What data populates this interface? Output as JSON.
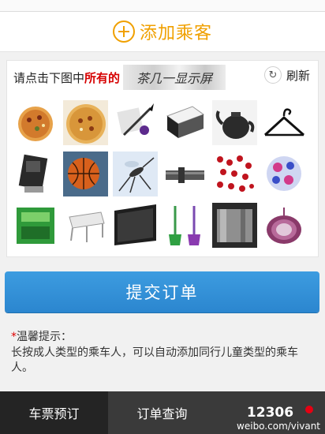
{
  "add_passenger": {
    "label": "添加乘客",
    "icon": "plus-circle-icon"
  },
  "captcha": {
    "instruction_prefix": "请点击下图中",
    "instruction_highlight": "所有的",
    "target_words": "茶几一显示屏",
    "refresh_label": "刷新",
    "images": [
      "pizza",
      "pizza",
      "pen",
      "box",
      "teapot",
      "hanger",
      "device",
      "basketball",
      "mosquito",
      "pipe",
      "red-beads",
      "ball",
      "green-box",
      "tray",
      "display",
      "broom",
      "metal-pot",
      "onion"
    ]
  },
  "submit_label": "提交订单",
  "tips": {
    "star": "*",
    "title": "温馨提示：",
    "body": "长按成人类型的乘车人，可以自动添加同行儿童类型的乘车人。"
  },
  "tabs": [
    {
      "label": "车票预订",
      "active": true
    },
    {
      "label": "订单查询",
      "active": false
    },
    {
      "label": "12306",
      "active": false
    }
  ],
  "watermark": "weibo.com/vivant",
  "colors": {
    "accent_orange": "#f0a000",
    "submit_blue": "#2b86cf",
    "tabbar": "#3a3a3a",
    "highlight_red": "#d60000"
  }
}
